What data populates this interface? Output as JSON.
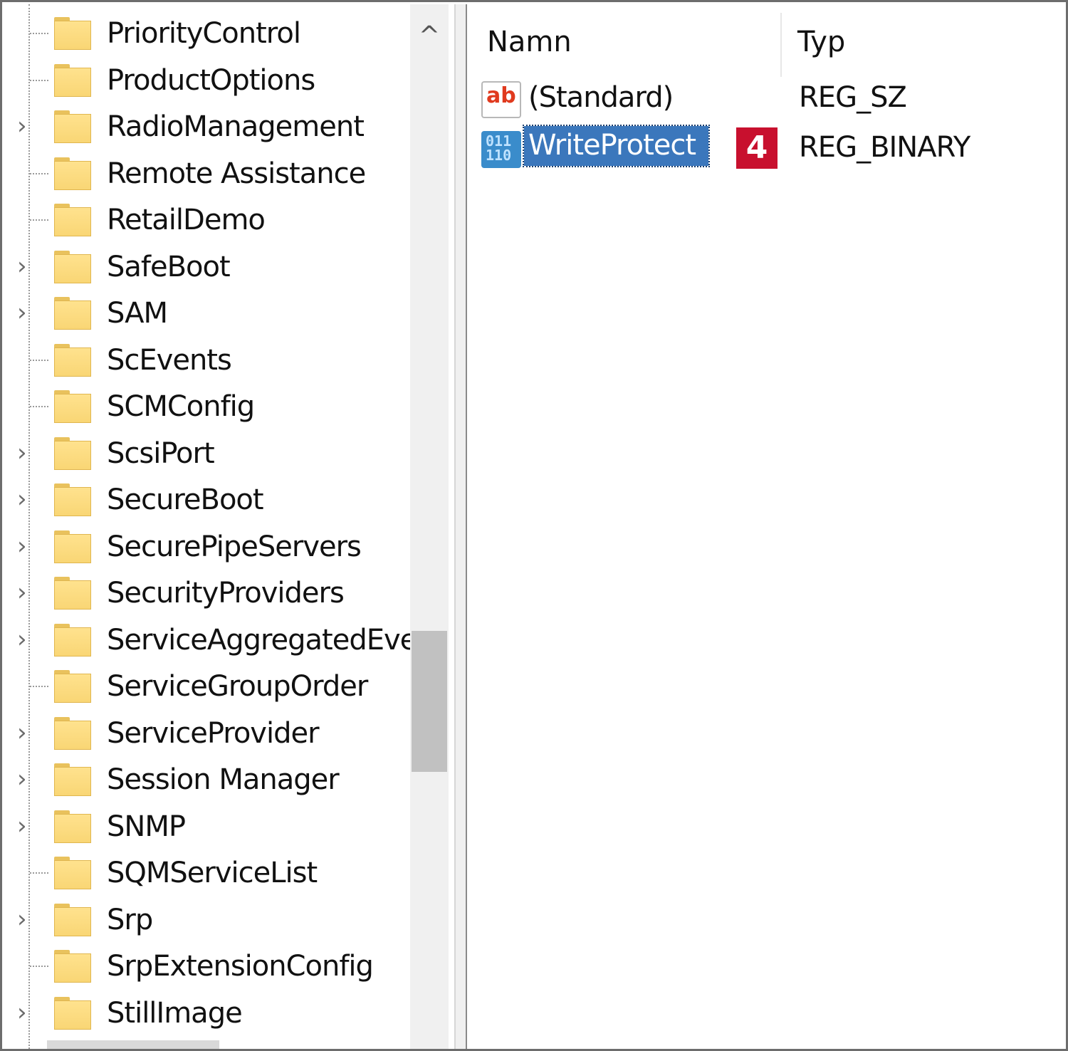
{
  "tree": {
    "items": [
      {
        "label": "PriorityControl",
        "expandable": false
      },
      {
        "label": "ProductOptions",
        "expandable": false
      },
      {
        "label": "RadioManagement",
        "expandable": true
      },
      {
        "label": "Remote Assistance",
        "expandable": false
      },
      {
        "label": "RetailDemo",
        "expandable": false
      },
      {
        "label": "SafeBoot",
        "expandable": true
      },
      {
        "label": "SAM",
        "expandable": true
      },
      {
        "label": "ScEvents",
        "expandable": false
      },
      {
        "label": "SCMConfig",
        "expandable": false
      },
      {
        "label": "ScsiPort",
        "expandable": true
      },
      {
        "label": "SecureBoot",
        "expandable": true
      },
      {
        "label": "SecurePipeServers",
        "expandable": true
      },
      {
        "label": "SecurityProviders",
        "expandable": true
      },
      {
        "label": "ServiceAggregatedEve",
        "expandable": true
      },
      {
        "label": "ServiceGroupOrder",
        "expandable": false
      },
      {
        "label": "ServiceProvider",
        "expandable": true
      },
      {
        "label": "Session Manager",
        "expandable": true
      },
      {
        "label": "SNMP",
        "expandable": true
      },
      {
        "label": "SQMServiceList",
        "expandable": false
      },
      {
        "label": "Srp",
        "expandable": true
      },
      {
        "label": "SrpExtensionConfig",
        "expandable": false
      },
      {
        "label": "StillImage",
        "expandable": true
      }
    ],
    "expander_glyph": "›",
    "scroll_up_glyph": "^"
  },
  "list": {
    "columns": {
      "name": "Namn",
      "type": "Typ"
    },
    "rows": [
      {
        "name": "(Standard)",
        "type": "REG_SZ",
        "icon": "string-value-icon",
        "icon_text": "ab",
        "selected": false
      },
      {
        "name": "WriteProtect",
        "type": "REG_BINARY",
        "icon": "binary-value-icon",
        "icon_text": "011\n110",
        "selected": true
      }
    ],
    "step_badge": "4"
  },
  "colors": {
    "selection": "#3b77bc",
    "badge": "#c8102e",
    "folder": "#f9d675"
  }
}
